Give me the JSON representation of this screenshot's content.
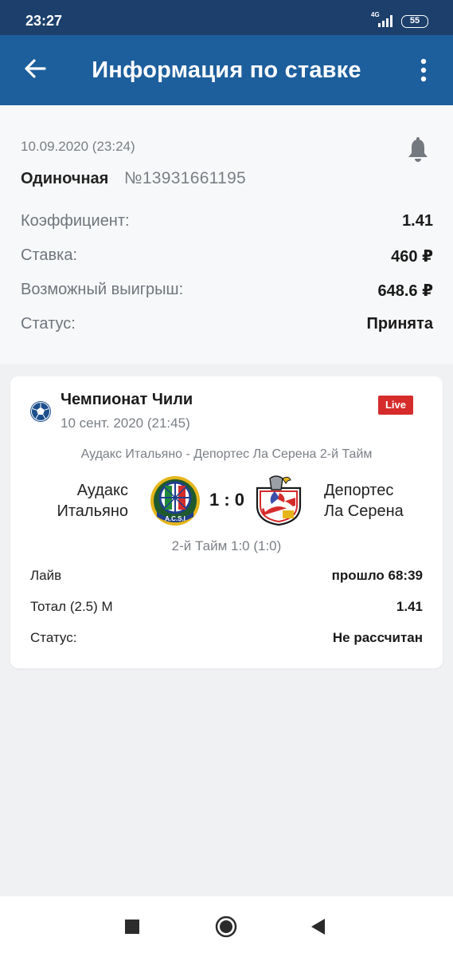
{
  "status_bar": {
    "time": "23:27",
    "network": "4G",
    "battery": "55"
  },
  "app_bar": {
    "title": "Информация по ставке",
    "back_icon": "arrow-left-icon",
    "menu_icon": "more-vertical-icon"
  },
  "bet": {
    "datetime": "10.09.2020 (23:24)",
    "type": "Одиночная",
    "number": "№13931661195",
    "rows": [
      {
        "label": "Коэффициент:",
        "value": "1.41"
      },
      {
        "label": "Ставка:",
        "value": "460 ₽"
      },
      {
        "label": "Возможный выигрыш:",
        "value": "648.6 ₽"
      },
      {
        "label": "Статус:",
        "value": "Принята"
      }
    ]
  },
  "event": {
    "league": "Чемпионат Чили",
    "date": "10 сент. 2020 (21:45)",
    "live_badge": "Live",
    "match_name": "Аудакс Итальяно - Депортес Ла Серена 2-й Тайм",
    "team1_line1": "Аудакс",
    "team1_line2": "Итальяно",
    "team2_line1": "Депортес",
    "team2_line2": "Ла Серена",
    "score": "1 : 0",
    "period": "2-й Тайм 1:0 (1:0)",
    "logo1_text": "A.C.S.I",
    "rows": [
      {
        "label": "Лайв",
        "value": "прошло 68:39"
      },
      {
        "label": "Тотал (2.5) М",
        "value": "1.41"
      },
      {
        "label": "Статус:",
        "value": "Не рассчитан"
      }
    ]
  },
  "colors": {
    "status_bar": "#1c3f6b",
    "app_bar": "#1d5e9c",
    "live": "#d62b2b"
  }
}
